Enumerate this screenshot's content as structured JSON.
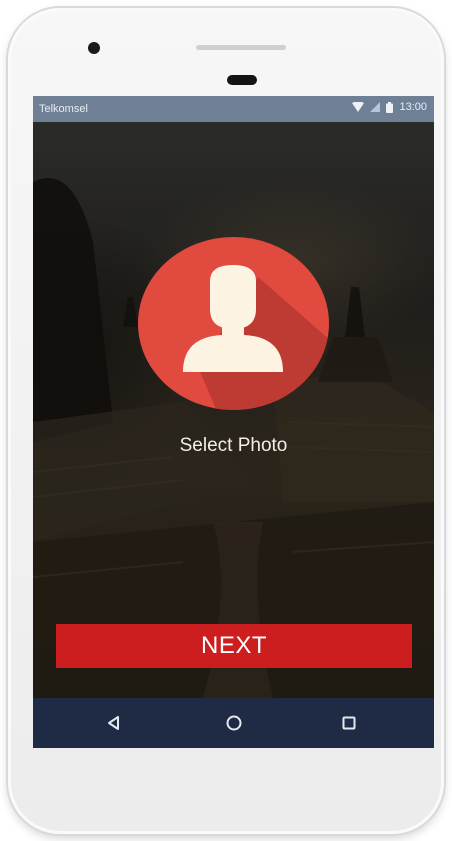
{
  "status_bar": {
    "carrier": "Telkomsel",
    "time": "13:00",
    "icons": [
      "wifi-icon",
      "signal-icon",
      "battery-icon"
    ]
  },
  "profile": {
    "select_photo_label": "Select Photo",
    "avatar_icon": "person-silhouette-icon",
    "avatar_color": "#e14b3f",
    "avatar_shadow_color": "#b93a31"
  },
  "actions": {
    "next_label": "NEXT",
    "next_color": "#cc1e1e"
  },
  "navigation": {
    "icons": [
      "back-icon",
      "home-icon",
      "recents-icon"
    ],
    "bar_color": "#1f2b44"
  }
}
